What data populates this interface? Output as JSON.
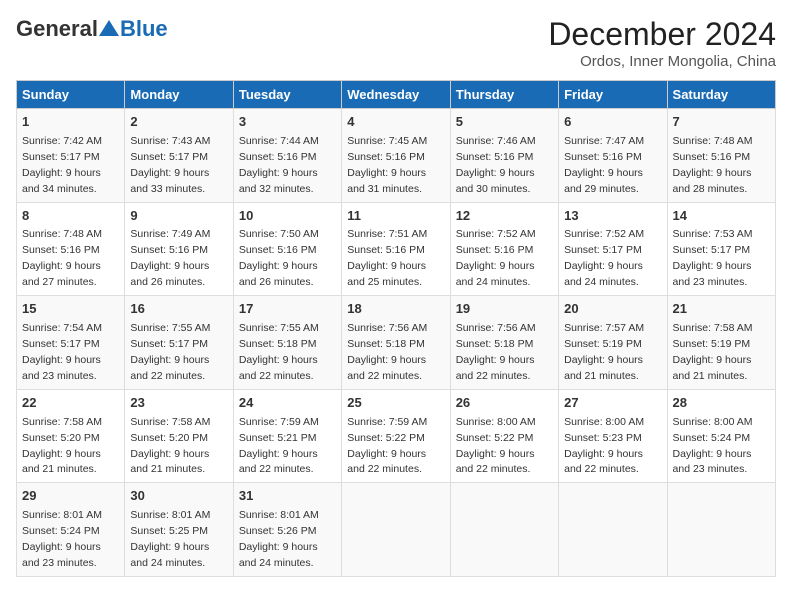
{
  "logo": {
    "general": "General",
    "blue": "Blue"
  },
  "title": "December 2024",
  "location": "Ordos, Inner Mongolia, China",
  "days_of_week": [
    "Sunday",
    "Monday",
    "Tuesday",
    "Wednesday",
    "Thursday",
    "Friday",
    "Saturday"
  ],
  "weeks": [
    [
      {
        "day": "1",
        "sunrise": "7:42 AM",
        "sunset": "5:17 PM",
        "daylight": "9 hours and 34 minutes."
      },
      {
        "day": "2",
        "sunrise": "7:43 AM",
        "sunset": "5:17 PM",
        "daylight": "9 hours and 33 minutes."
      },
      {
        "day": "3",
        "sunrise": "7:44 AM",
        "sunset": "5:16 PM",
        "daylight": "9 hours and 32 minutes."
      },
      {
        "day": "4",
        "sunrise": "7:45 AM",
        "sunset": "5:16 PM",
        "daylight": "9 hours and 31 minutes."
      },
      {
        "day": "5",
        "sunrise": "7:46 AM",
        "sunset": "5:16 PM",
        "daylight": "9 hours and 30 minutes."
      },
      {
        "day": "6",
        "sunrise": "7:47 AM",
        "sunset": "5:16 PM",
        "daylight": "9 hours and 29 minutes."
      },
      {
        "day": "7",
        "sunrise": "7:48 AM",
        "sunset": "5:16 PM",
        "daylight": "9 hours and 28 minutes."
      }
    ],
    [
      {
        "day": "8",
        "sunrise": "7:48 AM",
        "sunset": "5:16 PM",
        "daylight": "9 hours and 27 minutes."
      },
      {
        "day": "9",
        "sunrise": "7:49 AM",
        "sunset": "5:16 PM",
        "daylight": "9 hours and 26 minutes."
      },
      {
        "day": "10",
        "sunrise": "7:50 AM",
        "sunset": "5:16 PM",
        "daylight": "9 hours and 26 minutes."
      },
      {
        "day": "11",
        "sunrise": "7:51 AM",
        "sunset": "5:16 PM",
        "daylight": "9 hours and 25 minutes."
      },
      {
        "day": "12",
        "sunrise": "7:52 AM",
        "sunset": "5:16 PM",
        "daylight": "9 hours and 24 minutes."
      },
      {
        "day": "13",
        "sunrise": "7:52 AM",
        "sunset": "5:17 PM",
        "daylight": "9 hours and 24 minutes."
      },
      {
        "day": "14",
        "sunrise": "7:53 AM",
        "sunset": "5:17 PM",
        "daylight": "9 hours and 23 minutes."
      }
    ],
    [
      {
        "day": "15",
        "sunrise": "7:54 AM",
        "sunset": "5:17 PM",
        "daylight": "9 hours and 23 minutes."
      },
      {
        "day": "16",
        "sunrise": "7:55 AM",
        "sunset": "5:17 PM",
        "daylight": "9 hours and 22 minutes."
      },
      {
        "day": "17",
        "sunrise": "7:55 AM",
        "sunset": "5:18 PM",
        "daylight": "9 hours and 22 minutes."
      },
      {
        "day": "18",
        "sunrise": "7:56 AM",
        "sunset": "5:18 PM",
        "daylight": "9 hours and 22 minutes."
      },
      {
        "day": "19",
        "sunrise": "7:56 AM",
        "sunset": "5:18 PM",
        "daylight": "9 hours and 22 minutes."
      },
      {
        "day": "20",
        "sunrise": "7:57 AM",
        "sunset": "5:19 PM",
        "daylight": "9 hours and 21 minutes."
      },
      {
        "day": "21",
        "sunrise": "7:58 AM",
        "sunset": "5:19 PM",
        "daylight": "9 hours and 21 minutes."
      }
    ],
    [
      {
        "day": "22",
        "sunrise": "7:58 AM",
        "sunset": "5:20 PM",
        "daylight": "9 hours and 21 minutes."
      },
      {
        "day": "23",
        "sunrise": "7:58 AM",
        "sunset": "5:20 PM",
        "daylight": "9 hours and 21 minutes."
      },
      {
        "day": "24",
        "sunrise": "7:59 AM",
        "sunset": "5:21 PM",
        "daylight": "9 hours and 22 minutes."
      },
      {
        "day": "25",
        "sunrise": "7:59 AM",
        "sunset": "5:22 PM",
        "daylight": "9 hours and 22 minutes."
      },
      {
        "day": "26",
        "sunrise": "8:00 AM",
        "sunset": "5:22 PM",
        "daylight": "9 hours and 22 minutes."
      },
      {
        "day": "27",
        "sunrise": "8:00 AM",
        "sunset": "5:23 PM",
        "daylight": "9 hours and 22 minutes."
      },
      {
        "day": "28",
        "sunrise": "8:00 AM",
        "sunset": "5:24 PM",
        "daylight": "9 hours and 23 minutes."
      }
    ],
    [
      {
        "day": "29",
        "sunrise": "8:01 AM",
        "sunset": "5:24 PM",
        "daylight": "9 hours and 23 minutes."
      },
      {
        "day": "30",
        "sunrise": "8:01 AM",
        "sunset": "5:25 PM",
        "daylight": "9 hours and 24 minutes."
      },
      {
        "day": "31",
        "sunrise": "8:01 AM",
        "sunset": "5:26 PM",
        "daylight": "9 hours and 24 minutes."
      },
      null,
      null,
      null,
      null
    ]
  ]
}
